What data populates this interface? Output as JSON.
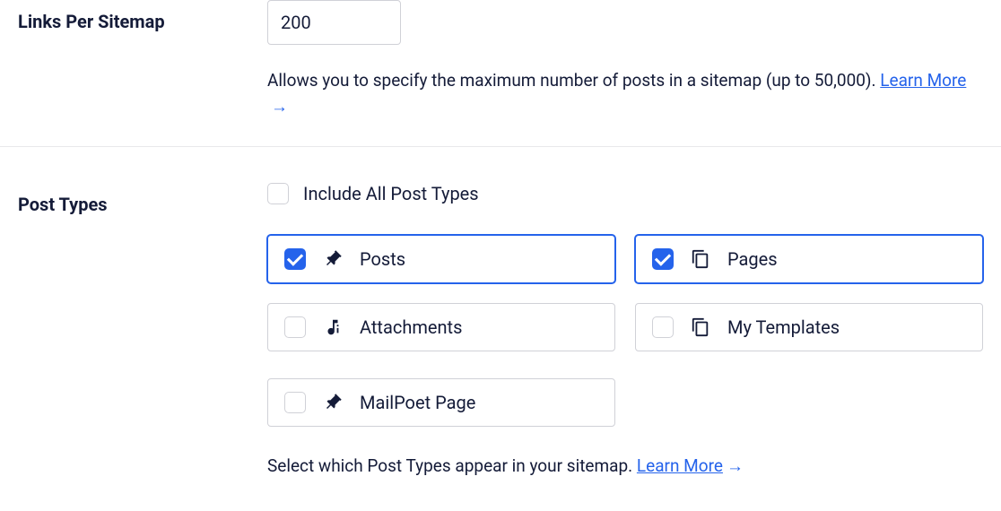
{
  "links_per_sitemap": {
    "label": "Links Per Sitemap",
    "value": "200",
    "help_prefix": "Allows you to specify the maximum number of posts in a sitemap (up to 50,000). ",
    "learn_more": "Learn More"
  },
  "post_types": {
    "label": "Post Types",
    "include_all_label": "Include All Post Types",
    "include_all_checked": false,
    "items": [
      {
        "id": "posts",
        "label": "Posts",
        "checked": true,
        "icon": "pin"
      },
      {
        "id": "pages",
        "label": "Pages",
        "checked": true,
        "icon": "copy"
      },
      {
        "id": "attachments",
        "label": "Attachments",
        "checked": false,
        "icon": "media"
      },
      {
        "id": "my-templates",
        "label": "My Templates",
        "checked": false,
        "icon": "copy"
      },
      {
        "id": "mailpoet-page",
        "label": "MailPoet Page",
        "checked": false,
        "icon": "pin"
      }
    ],
    "help_prefix": "Select which Post Types appear in your sitemap. ",
    "learn_more": "Learn More"
  }
}
